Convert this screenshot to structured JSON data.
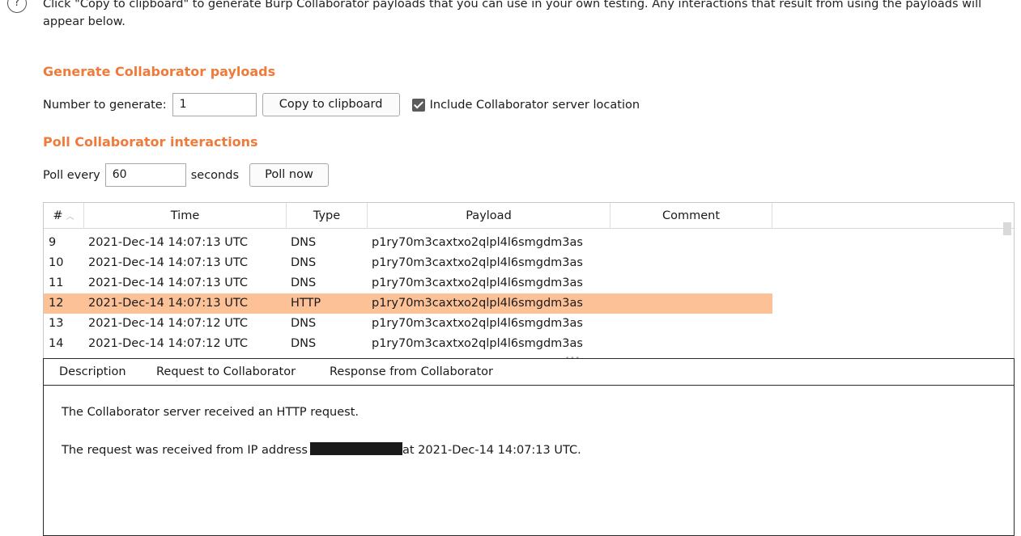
{
  "intro": {
    "text": "Click \"Copy to clipboard\" to generate Burp Collaborator payloads that you can use in your own testing. Any interactions that result from using the payloads will appear below."
  },
  "generate": {
    "title": "Generate Collaborator payloads",
    "number_label": "Number to generate:",
    "number_value": "1",
    "copy_button": "Copy to clipboard",
    "include_label": "Include Collaborator server location",
    "include_checked": true
  },
  "poll": {
    "title": "Poll Collaborator interactions",
    "poll_every_label": "Poll every",
    "poll_value": "60",
    "seconds_label": "seconds",
    "poll_now_button": "Poll now"
  },
  "table": {
    "columns": [
      "#",
      "Time",
      "Type",
      "Payload",
      "Comment"
    ],
    "rows": [
      {
        "num": "9",
        "time": "2021-Dec-14 14:07:13 UTC",
        "type": "DNS",
        "payload": "p1ry70m3caxtxo2qlpl4l6smgdm3as",
        "comment": "",
        "selected": false
      },
      {
        "num": "10",
        "time": "2021-Dec-14 14:07:13 UTC",
        "type": "DNS",
        "payload": "p1ry70m3caxtxo2qlpl4l6smgdm3as",
        "comment": "",
        "selected": false
      },
      {
        "num": "11",
        "time": "2021-Dec-14 14:07:13 UTC",
        "type": "DNS",
        "payload": "p1ry70m3caxtxo2qlpl4l6smgdm3as",
        "comment": "",
        "selected": false
      },
      {
        "num": "12",
        "time": "2021-Dec-14 14:07:13 UTC",
        "type": "HTTP",
        "payload": "p1ry70m3caxtxo2qlpl4l6smgdm3as",
        "comment": "",
        "selected": true
      },
      {
        "num": "13",
        "time": "2021-Dec-14 14:07:12 UTC",
        "type": "DNS",
        "payload": "p1ry70m3caxtxo2qlpl4l6smgdm3as",
        "comment": "",
        "selected": false
      },
      {
        "num": "14",
        "time": "2021-Dec-14 14:07:12 UTC",
        "type": "DNS",
        "payload": "p1ry70m3caxtxo2qlpl4l6smgdm3as",
        "comment": "",
        "selected": false
      }
    ],
    "selected_color": "#fcc197"
  },
  "details": {
    "tabs": [
      "Description",
      "Request to Collaborator",
      "Response from Collaborator"
    ],
    "active_tab": "Description",
    "line1": "The Collaborator server received an HTTP request.",
    "line2_prefix": "The request was received from IP address",
    "line2_suffix": "at 2021-Dec-14 14:07:13 UTC."
  },
  "colors": {
    "accent": "#f07a3a"
  }
}
